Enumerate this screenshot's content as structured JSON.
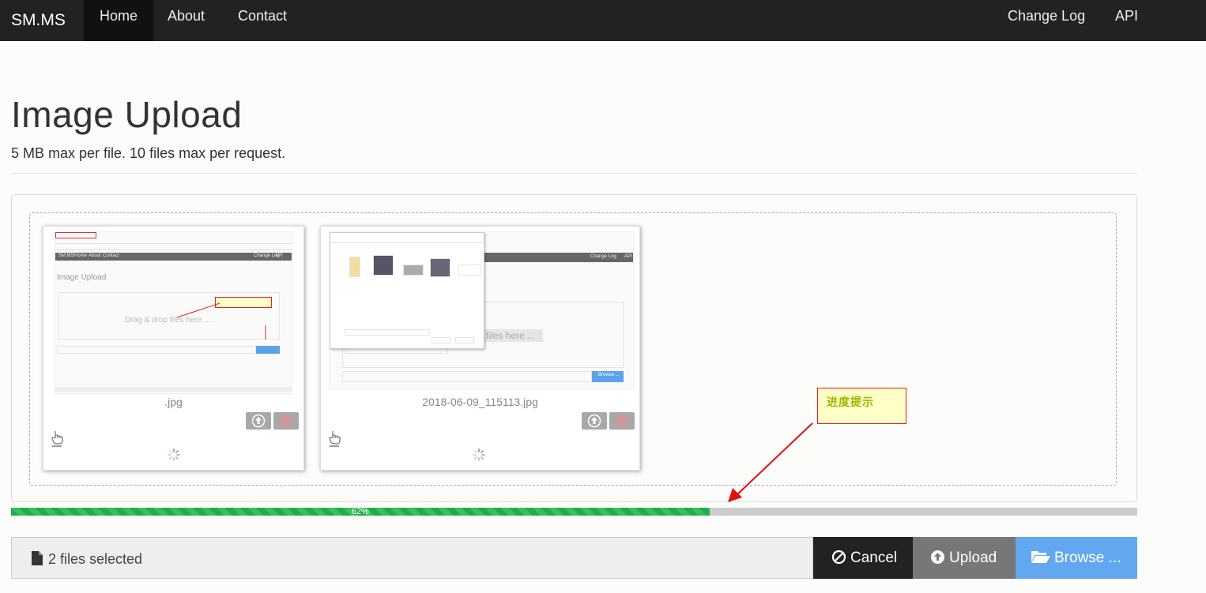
{
  "navbar": {
    "brand": "SM.MS",
    "links": [
      "Home",
      "About",
      "Contact"
    ],
    "right_links": [
      "Change Log",
      "API"
    ]
  },
  "header": {
    "title": "Image Upload",
    "subtitle": "5 MB max per file. 10 files max per request."
  },
  "files": [
    {
      "caption": ".jpg",
      "preview": {
        "nav_items": [
          "SM.MS",
          "Home",
          "About",
          "Contact",
          "Change Log",
          "API"
        ],
        "title": "Image Upload",
        "drop_text": "Drag & drop files here ...",
        "button": "Browse ..."
      }
    },
    {
      "caption": "2018-06-09_115113.jpg",
      "preview": {
        "nav_items": [
          "Change Log",
          "API"
        ],
        "drop_text": "files here ...",
        "button": "Browse ..."
      }
    }
  ],
  "progress": {
    "percent": 62,
    "label": "62%"
  },
  "annotation": {
    "text": "进度提示"
  },
  "footer": {
    "caption": "2 files selected",
    "cancel_label": "Cancel",
    "upload_label": "Upload",
    "browse_label": "Browse ..."
  },
  "colors": {
    "navbar": "#222222",
    "progress": "#1bb046",
    "browse": "#62a8f0",
    "cancel": "#222222",
    "upload": "#777777"
  }
}
